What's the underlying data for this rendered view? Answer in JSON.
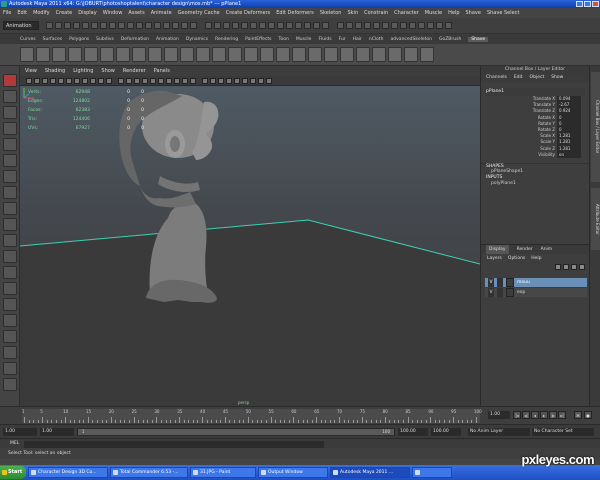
{
  "window": {
    "title": "Autodesk Maya 2011 x64: G:\\JOBURT\\photoshoptalent\\character design\\mos.mb*  ---  pPlane1"
  },
  "menubar": [
    "File",
    "Edit",
    "Modify",
    "Create",
    "Display",
    "Window",
    "Assets",
    "Animate",
    "Geometry Cache",
    "Create Deformers",
    "Edit Deformers",
    "Skeleton",
    "Skin",
    "Constrain",
    "Character",
    "Muscle",
    "Help"
  ],
  "menubar_extra": [
    "Shave",
    "Shave Select"
  ],
  "statusline": {
    "mode": "Animation"
  },
  "shelf_tabs": [
    "Curves",
    "Surfaces",
    "Polygons",
    "Subdivs",
    "Deformation",
    "Animation",
    "Dynamics",
    "Rendering",
    "PaintEffects",
    "Toon",
    "Muscle",
    "Fluids",
    "Fur",
    "Hair",
    "nCloth",
    "advancedSkeleton",
    "GoZBrush",
    "Shave"
  ],
  "shelf_active": "Shave",
  "panel_menu": [
    "View",
    "Shading",
    "Lighting",
    "Show",
    "Renderer",
    "Panels"
  ],
  "hud": {
    "rows": [
      {
        "label": "Verts:",
        "a": "62948",
        "b": "0",
        "c": "0"
      },
      {
        "label": "Edges:",
        "a": "124802",
        "b": "0",
        "c": "0"
      },
      {
        "label": "Faces:",
        "a": "62383",
        "b": "0",
        "c": "0"
      },
      {
        "label": "Tris:",
        "a": "124406",
        "b": "0",
        "c": "0"
      },
      {
        "label": "UVs:",
        "a": "67927",
        "b": "0",
        "c": "0"
      }
    ]
  },
  "viewport": {
    "camera": "persp"
  },
  "channel_box": {
    "header": "Channel Box / Layer Editor",
    "menu": [
      "Channels",
      "Edit",
      "Object",
      "Show"
    ],
    "object": "pPlane1",
    "attributes": [
      {
        "name": "Translate X",
        "value": "0.094"
      },
      {
        "name": "Translate Y",
        "value": "-2.67"
      },
      {
        "name": "Translate Z",
        "value": "0.924"
      },
      {
        "name": "Rotate X",
        "value": "0"
      },
      {
        "name": "Rotate Y",
        "value": "0"
      },
      {
        "name": "Rotate Z",
        "value": "0"
      },
      {
        "name": "Scale X",
        "value": "1.281"
      },
      {
        "name": "Scale Y",
        "value": "1.281"
      },
      {
        "name": "Scale Z",
        "value": "1.281"
      },
      {
        "name": "Visibility",
        "value": "on"
      }
    ],
    "shapes_header": "SHAPES",
    "shapes": [
      "pPlaneShape1"
    ],
    "inputs_header": "INPUTS",
    "inputs": [
      "polyPlane1"
    ]
  },
  "layer_editor": {
    "tabs": [
      "Display",
      "Render",
      "Anim"
    ],
    "active_tab": "Display",
    "menu": [
      "Layers",
      "Options",
      "Help"
    ],
    "layers": [
      {
        "vis": "V",
        "name": "mouu",
        "selected": true
      },
      {
        "vis": "V",
        "name": "exp",
        "selected": false
      }
    ]
  },
  "side_tabs": [
    "Channel Box / Layer Editor",
    "Attribute Editor"
  ],
  "timeslider": {
    "ticks": [
      "1",
      "5",
      "10",
      "15",
      "20",
      "25",
      "30",
      "35",
      "40",
      "45",
      "50",
      "55",
      "60",
      "65",
      "70",
      "75",
      "80",
      "85",
      "90",
      "95",
      "100"
    ],
    "current_frame": "1.00"
  },
  "rangeslider": {
    "start": "1.00",
    "playback_start": "1.00",
    "range_label": "1",
    "range_end": "100",
    "playback_end": "100.00",
    "end": "100.00",
    "anim_layer": "No Anim Layer",
    "character": "No Character Set"
  },
  "cmdline": {
    "label": "MEL"
  },
  "helpline": {
    "text": "Select Tool: select an object"
  },
  "taskbar": {
    "start": "Start",
    "tasks": [
      {
        "label": "Character Design 3D Co...",
        "active": false
      },
      {
        "label": "Total Commander 6.53 -...",
        "active": false
      },
      {
        "label": "31.JPG - Paint",
        "active": false
      },
      {
        "label": "Output Window",
        "active": false
      },
      {
        "label": "Autodesk Maya 2011 ...",
        "active": true
      },
      {
        "label": "",
        "active": false
      }
    ]
  },
  "watermark": "pxleyes.com",
  "colors": {
    "grid_line": "#3ad1b0",
    "title_blue": "#0b3fb0",
    "selected_layer": "#6a90b8"
  }
}
